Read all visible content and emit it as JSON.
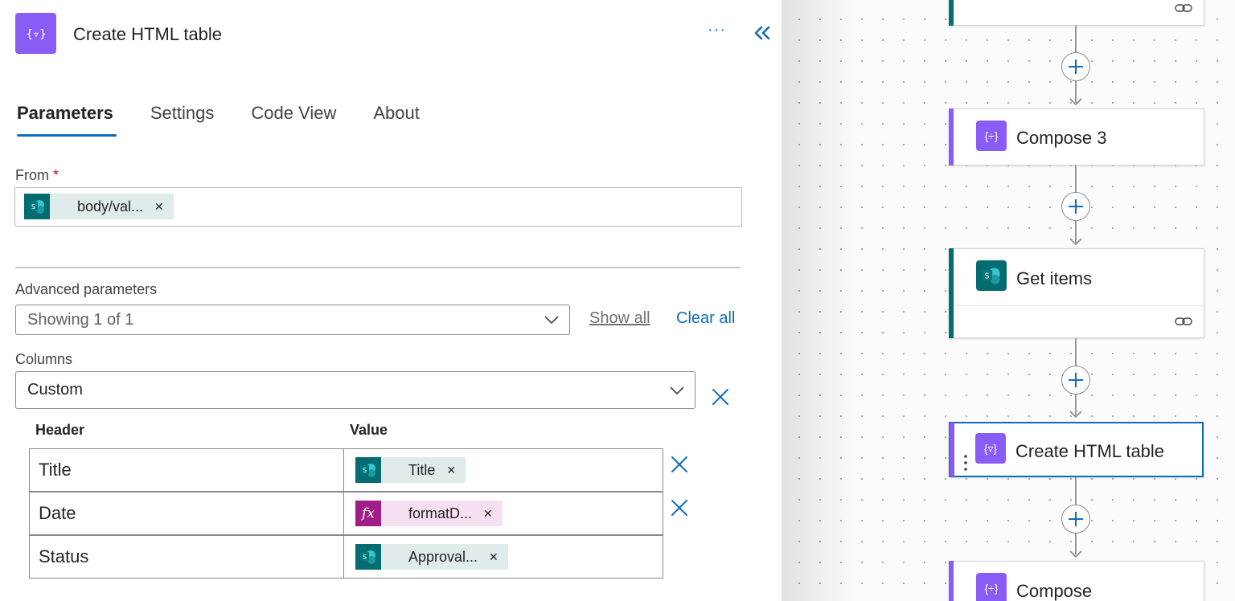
{
  "header": {
    "title": "Create HTML table",
    "more_label": "···"
  },
  "tabs": [
    {
      "label": "Parameters",
      "active": true
    },
    {
      "label": "Settings",
      "active": false
    },
    {
      "label": "Code View",
      "active": false
    },
    {
      "label": "About",
      "active": false
    }
  ],
  "from": {
    "label": "From",
    "required_mark": "*",
    "token": {
      "text": "body/val...",
      "source": "sharepoint-icon"
    }
  },
  "advanced": {
    "label": "Advanced parameters",
    "showing": "Showing 1 of 1",
    "show_all": "Show all",
    "clear_all": "Clear all"
  },
  "columns": {
    "label": "Columns",
    "mode": "Custom",
    "header_label": "Header",
    "value_label": "Value",
    "rows": [
      {
        "header": "Title",
        "value": "Title",
        "source": "sharepoint-icon",
        "removable": true
      },
      {
        "header": "Date",
        "value": "formatD...",
        "source": "function-icon",
        "removable": true
      },
      {
        "header": "Status",
        "value": "Approval...",
        "source": "sharepoint-icon",
        "removable": false
      }
    ]
  },
  "flow": {
    "cards": [
      {
        "title": "Compose 3",
        "kind": "compose"
      },
      {
        "title": "Get items",
        "kind": "sharepoint"
      },
      {
        "title": "Create HTML table",
        "kind": "html-table",
        "selected": true
      },
      {
        "title": "Compose",
        "kind": "compose"
      }
    ]
  },
  "colors": {
    "accent": "#0f6cbd",
    "data_operation": "#8a5cf6",
    "sharepoint": "#036c70",
    "function": "#a11d87"
  }
}
